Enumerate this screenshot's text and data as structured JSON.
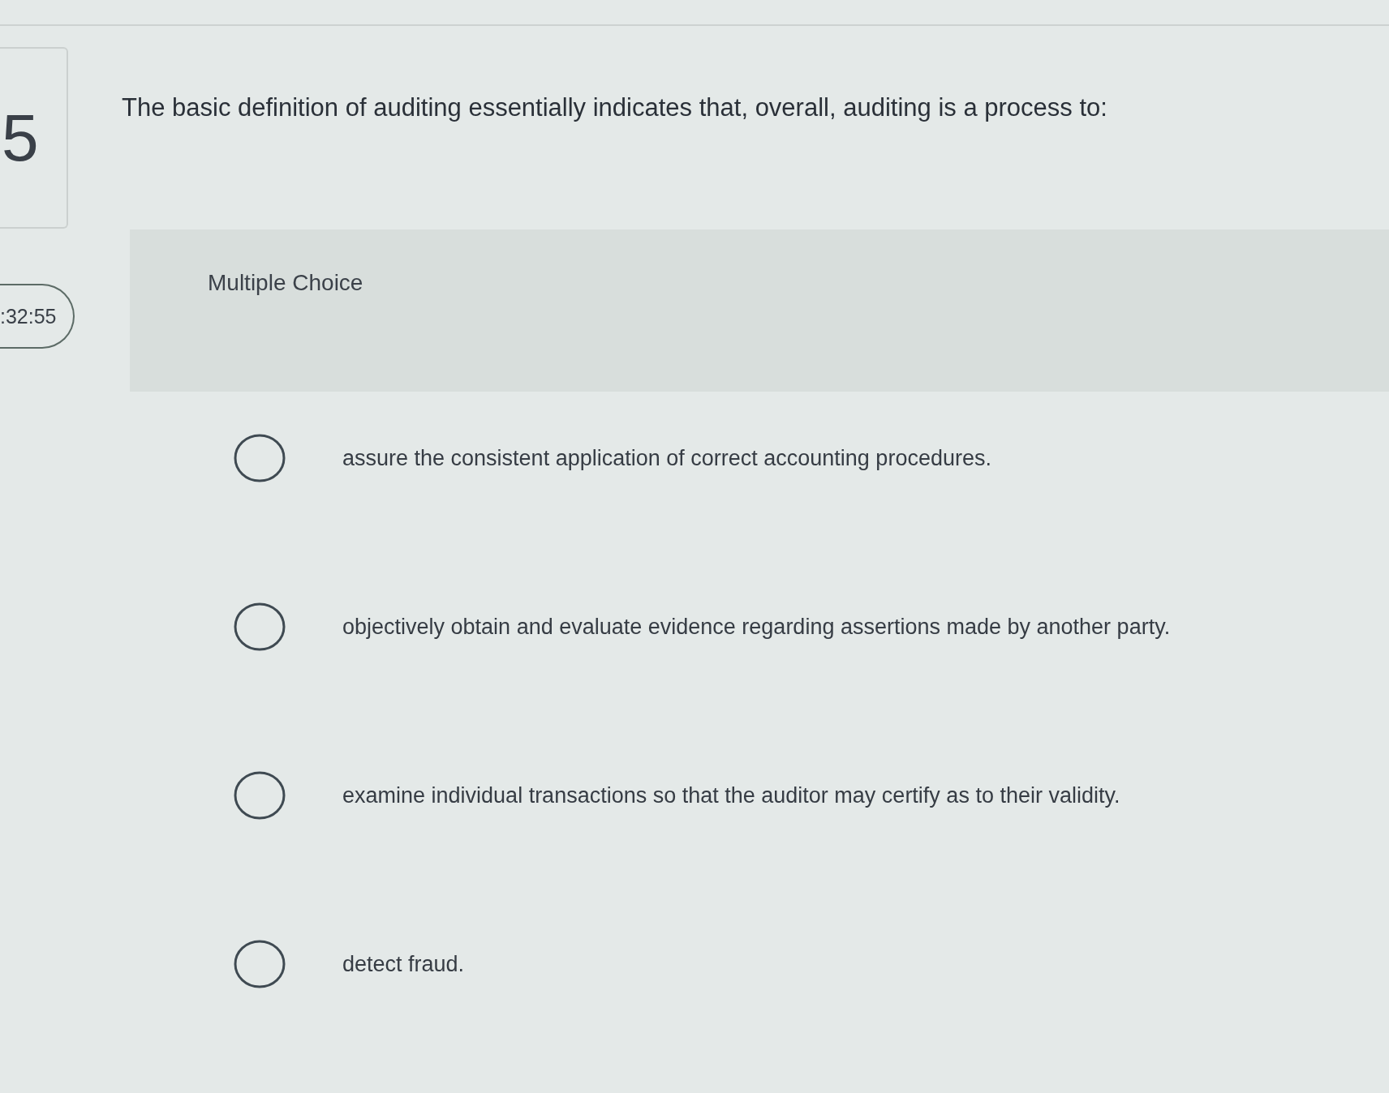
{
  "question_number": "5",
  "timer": ":32:55",
  "question": {
    "text": "The basic definition of auditing essentially indicates that, overall, auditing is a process to:"
  },
  "answer_panel": {
    "label": "Multiple Choice"
  },
  "options": [
    {
      "text": "assure the consistent application of correct accounting procedures.",
      "selected": false
    },
    {
      "text": "objectively obtain and evaluate evidence regarding assertions made by another party.",
      "selected": false
    },
    {
      "text": "examine individual transactions so that the auditor may certify as to their validity.",
      "selected": false
    },
    {
      "text": "detect fraud.",
      "selected": false
    }
  ]
}
